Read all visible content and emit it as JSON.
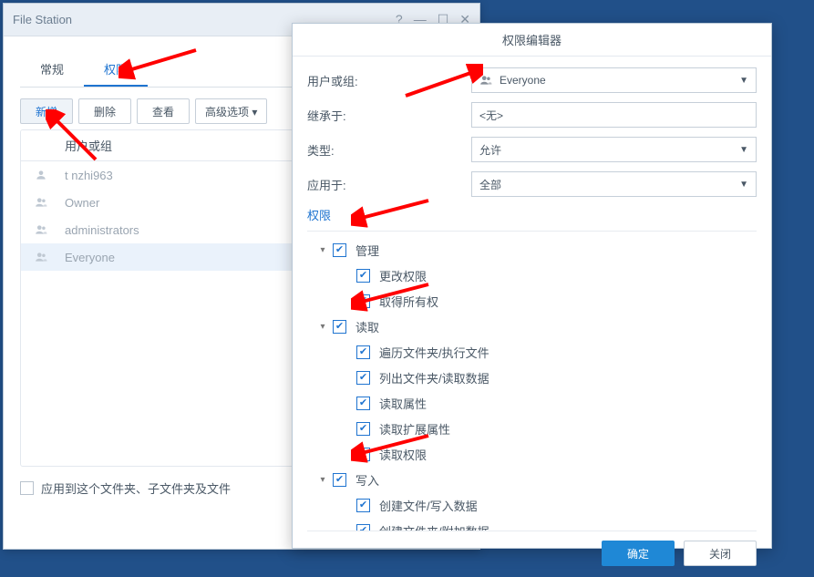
{
  "mainWindow": {
    "title": "File Station",
    "tabs": {
      "general": "常规",
      "perm": "权限"
    },
    "toolbar": {
      "add": "新增",
      "delete": "删除",
      "view": "查看",
      "advanced": "高级选项 ▾"
    },
    "table": {
      "header": "用户或组",
      "rows": [
        {
          "name": "t nzhi963",
          "icon": "user"
        },
        {
          "name": "Owner",
          "icon": "group"
        },
        {
          "name": "administrators",
          "icon": "group"
        },
        {
          "name": "Everyone",
          "icon": "group"
        }
      ],
      "selectedIndex": 3
    },
    "applyRecursive": "应用到这个文件夹、子文件夹及文件"
  },
  "dialog": {
    "title": "权限编辑器",
    "labels": {
      "userGroup": "用户或组:",
      "inherit": "继承于:",
      "type": "类型:",
      "applyTo": "应用于:",
      "permission": "权限"
    },
    "fields": {
      "userGroup": "Everyone",
      "inherit": "<无>",
      "type": "允许",
      "applyTo": "全部"
    },
    "tree": [
      {
        "label": "管理",
        "level": 0,
        "checked": true,
        "expandable": true
      },
      {
        "label": "更改权限",
        "level": 1,
        "checked": true
      },
      {
        "label": "取得所有权",
        "level": 1,
        "checked": true
      },
      {
        "label": "读取",
        "level": 0,
        "checked": true,
        "expandable": true
      },
      {
        "label": "遍历文件夹/执行文件",
        "level": 1,
        "checked": true
      },
      {
        "label": "列出文件夹/读取数据",
        "level": 1,
        "checked": true
      },
      {
        "label": "读取属性",
        "level": 1,
        "checked": true
      },
      {
        "label": "读取扩展属性",
        "level": 1,
        "checked": true
      },
      {
        "label": "读取权限",
        "level": 1,
        "checked": true
      },
      {
        "label": "写入",
        "level": 0,
        "checked": true,
        "expandable": true
      },
      {
        "label": "创建文件/写入数据",
        "level": 1,
        "checked": true
      },
      {
        "label": "创建文件夹/附加数据",
        "level": 1,
        "checked": true
      }
    ],
    "buttons": {
      "ok": "确定",
      "cancel": "关闭"
    }
  }
}
